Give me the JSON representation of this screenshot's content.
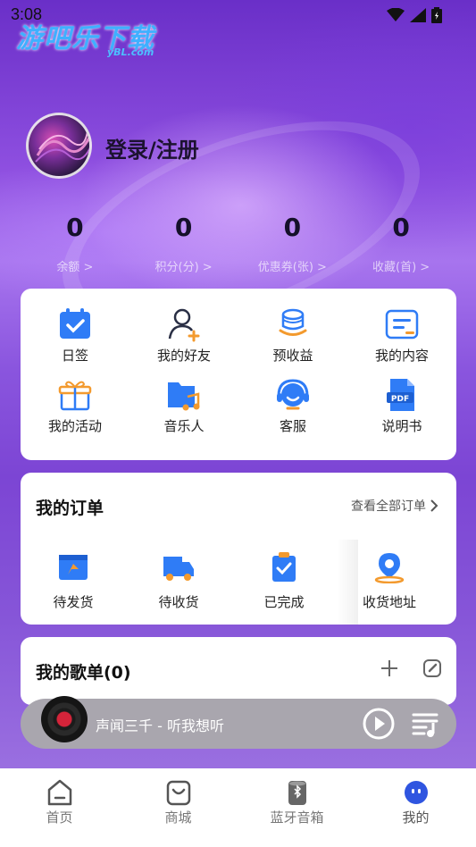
{
  "status": {
    "time": "3:08"
  },
  "watermark": {
    "title": "游吧乐下载",
    "sub": "yBL.com"
  },
  "profile": {
    "login_label": "登录/注册"
  },
  "stats": [
    {
      "value": "0",
      "label": "余额 >"
    },
    {
      "value": "0",
      "label": "积分(分) >"
    },
    {
      "value": "0",
      "label": "优惠券(张) >"
    },
    {
      "value": "0",
      "label": "收藏(首) >"
    }
  ],
  "grid": [
    {
      "label": "日签",
      "icon": "calendar-check-icon"
    },
    {
      "label": "我的好友",
      "icon": "add-friend-icon"
    },
    {
      "label": "预收益",
      "icon": "coins-icon"
    },
    {
      "label": "我的内容",
      "icon": "content-card-icon"
    },
    {
      "label": "我的活动",
      "icon": "gift-icon"
    },
    {
      "label": "音乐人",
      "icon": "music-folder-icon"
    },
    {
      "label": "客服",
      "icon": "headset-icon"
    },
    {
      "label": "说明书",
      "icon": "pdf-icon"
    }
  ],
  "orders": {
    "title": "我的订单",
    "view_all": "查看全部订单",
    "items": [
      {
        "label": "待发货",
        "icon": "pending-ship-icon"
      },
      {
        "label": "待收货",
        "icon": "truck-icon"
      },
      {
        "label": "已完成",
        "icon": "clipboard-check-icon"
      },
      {
        "label": "收货地址",
        "icon": "location-pin-icon"
      }
    ]
  },
  "playlist": {
    "title": "我的歌单(0)"
  },
  "player": {
    "track": "声闻三千 - 听我想听"
  },
  "tabs": [
    {
      "label": "首页",
      "icon": "home-icon"
    },
    {
      "label": "商城",
      "icon": "shop-bag-icon"
    },
    {
      "label": "蓝牙音箱",
      "icon": "bluetooth-speaker-icon"
    },
    {
      "label": "我的",
      "icon": "profile-face-icon"
    }
  ],
  "colors": {
    "accent_blue": "#2f7cf6",
    "accent_orange": "#f39a2e",
    "hero_purple": "#8e4fe0"
  }
}
